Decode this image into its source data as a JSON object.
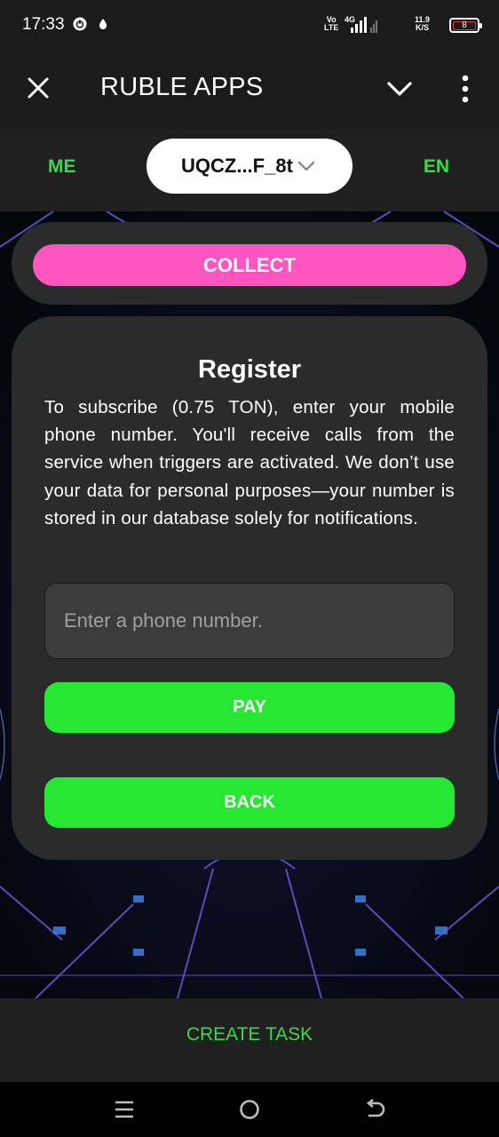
{
  "status_bar": {
    "time": "17:33",
    "network_top": "Vo",
    "network_bottom": "LTE",
    "gen": "4G",
    "speed_top": "11.9",
    "speed_bottom": "K/S",
    "battery": "8"
  },
  "app_bar": {
    "title": "RUBLE APPS",
    "icons": [
      "close-icon",
      "chevron-down-icon",
      "more-vertical-icon"
    ]
  },
  "nav": {
    "me_label": "ME",
    "wallet_label": "UQCZ...F_8t",
    "lang_label": "EN"
  },
  "collect": {
    "button_label": "COLLECT"
  },
  "register": {
    "title": "Register",
    "description": "To subscribe (0.75 TON), enter your mobile phone number. You'll receive calls from the service when triggers are activated. We don’t use your data for personal purposes—your number is stored in our database solely for notifications.",
    "phone_value": "",
    "phone_placeholder": "Enter a phone number.",
    "pay_label": "PAY",
    "back_label": "BACK"
  },
  "bottom": {
    "create_task_label": "CREATE TASK"
  },
  "colors": {
    "accent_green": "#26e833",
    "nav_green": "#39d94a",
    "collect_pink": "#ff55c1",
    "card_bg": "#2b2b2b"
  }
}
